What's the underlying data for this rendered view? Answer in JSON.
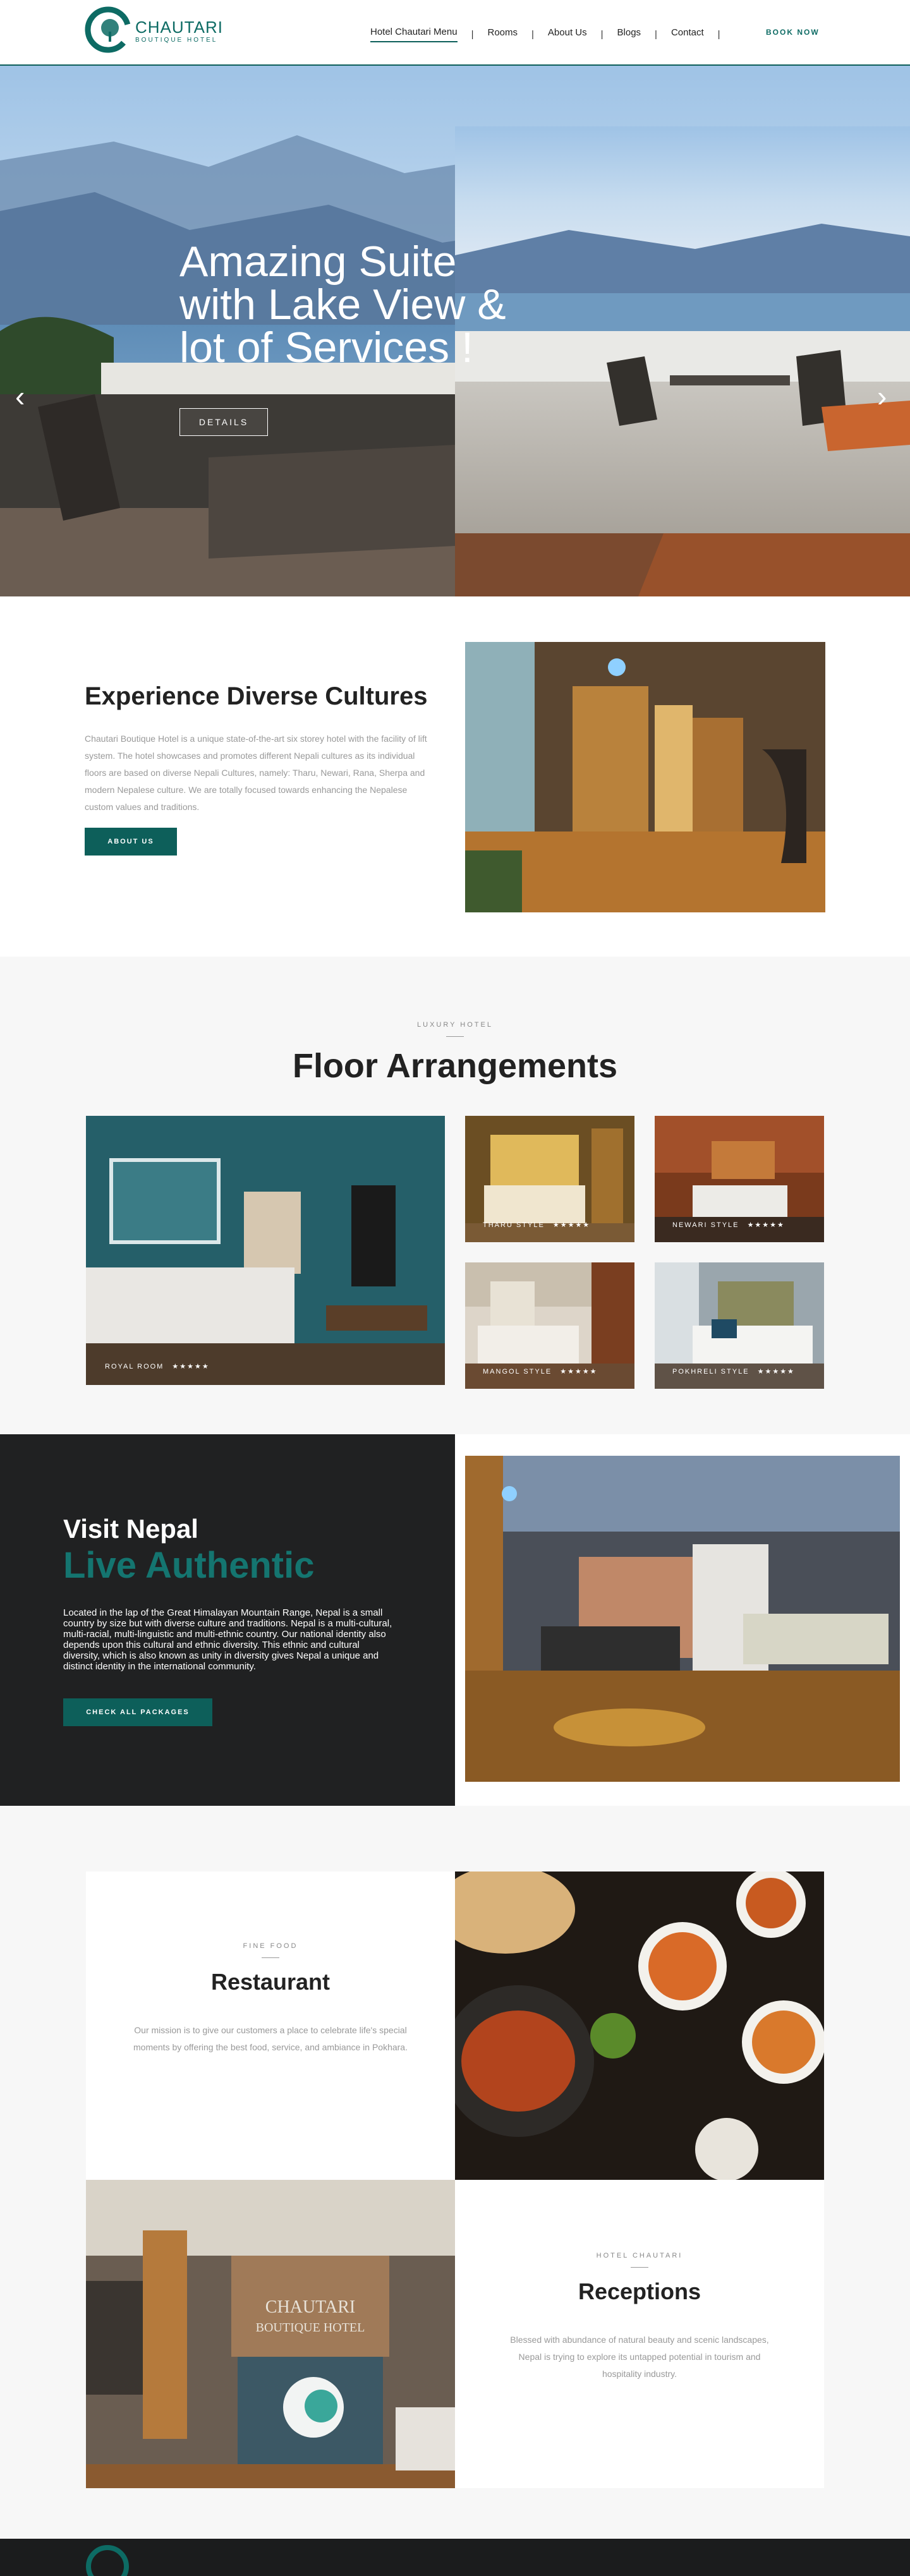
{
  "brand": {
    "name": "CHAUTARI",
    "tagline": "BOUTIQUE HOTEL"
  },
  "nav": {
    "items": [
      {
        "label": "Hotel Chautari Menu",
        "active": true
      },
      {
        "label": "Rooms"
      },
      {
        "label": "About Us"
      },
      {
        "label": "Blogs"
      },
      {
        "label": "Contact"
      }
    ],
    "cta": "BOOK NOW"
  },
  "hero": {
    "title_lines": [
      "Amazing Suite",
      "with Lake View &",
      "lot of Services !"
    ],
    "button": "DETAILS",
    "prev_icon": "chevron-left-icon",
    "next_icon": "chevron-right-icon",
    "slides": 2,
    "active_slide": 1
  },
  "cultures": {
    "title": "Experience Diverse Cultures",
    "text": "Chautari Boutique Hotel is a unique state-of-the-art six storey hotel with the facility of lift system. The hotel showcases and promotes different Nepali cultures as its individual floors are based on diverse Nepali Cultures, namely: Tharu, Newari, Rana, Sherpa and modern Nepalese culture. We are totally focused towards enhancing the Nepalese custom values and traditions.",
    "button": "ABOUT US"
  },
  "floors": {
    "kicker": "LUXURY HOTEL",
    "title": "Floor Arrangements",
    "rooms": [
      {
        "name": "ROYAL ROOM",
        "stars": 5
      },
      {
        "name": "THARU STYLE",
        "stars": 5
      },
      {
        "name": "NEWARI STYLE",
        "stars": 5
      },
      {
        "name": "MANGOL STYLE",
        "stars": 5
      },
      {
        "name": "POKHRELI STYLE",
        "stars": 5
      }
    ]
  },
  "visit": {
    "title": "Visit Nepal",
    "subtitle": "Live Authentic",
    "text": "Located in the lap of the Great Himalayan Mountain Range, Nepal is a small country by size but with diverse culture and traditions. Nepal is a multi-cultural, multi-racial, multi-linguistic and multi-ethnic country. Our national identity also depends upon this cultural and ethnic diversity. This ethnic and cultural diversity, which is also known as unity in diversity gives Nepal a unique and distinct identity in the international community.",
    "button": "CHECK ALL PACKAGES"
  },
  "restaurant": {
    "kicker": "FINE FOOD",
    "title": "Restaurant",
    "text": "Our mission is to give our customers a place to celebrate life's special moments by offering the best food, service, and ambiance in Pokhara."
  },
  "receptions": {
    "kicker": "HOTEL CHAUTARI",
    "title": "Receptions",
    "text": "Blessed with abundance of natural beauty and scenic landscapes, Nepal is trying to explore its untapped potential in tourism and hospitality industry.",
    "sign_line1": "CHAUTARI",
    "sign_line2": "BOUTIQUE HOTEL"
  },
  "colors": {
    "brand": "#0d5f5a",
    "accent_text": "#147570",
    "dark_panel": "#202122"
  }
}
